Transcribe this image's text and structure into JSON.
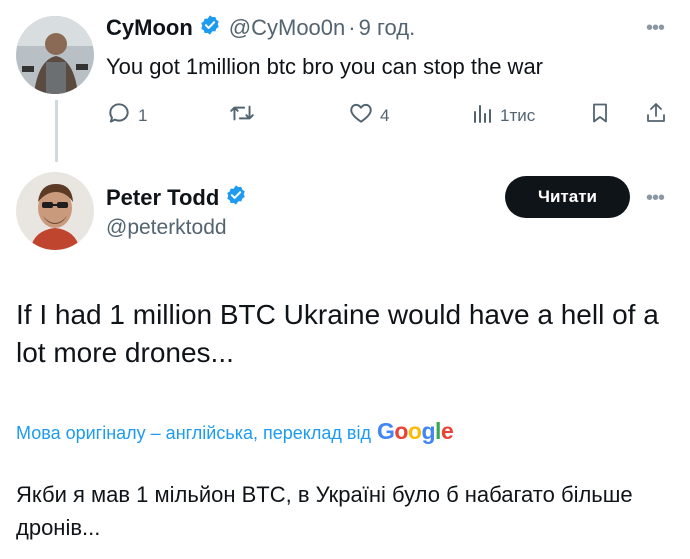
{
  "reply_tweet": {
    "display_name": "СуMoon",
    "handle": "@СуMoo0n",
    "separator": "·",
    "time": "9 год.",
    "text": "You got 1million btc bro you can stop the war",
    "replies": "1",
    "likes": "4",
    "views": "1тис"
  },
  "main_tweet": {
    "display_name": "Peter Todd",
    "handle": "@peterktodd",
    "follow_label": "Читати",
    "text": "If I had 1 million BTC Ukraine would have a hell of a lot more drones...",
    "translation_note": "Мова оригіналу – англійська, переклад від",
    "translation_provider": "Google",
    "translated_text": "Якби я мав 1 мільйон BTC, в Україні було б набагато більше дронів..."
  },
  "colors": {
    "accent": "#1d9bf0",
    "muted": "#536471",
    "text": "#0f1419",
    "button_bg": "#0f1419"
  },
  "icons": [
    "verified-badge-icon",
    "more-icon",
    "reply-icon",
    "retweet-icon",
    "like-icon",
    "views-icon",
    "bookmark-icon",
    "share-icon"
  ]
}
